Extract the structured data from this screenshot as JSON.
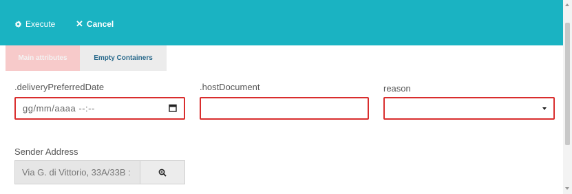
{
  "toolbar": {
    "execute_label": "Execute",
    "execute_icon": "gear-icon",
    "cancel_label": "Cancel",
    "cancel_icon": "close-icon",
    "background_color": "#1ab3c2"
  },
  "tabs": [
    {
      "label": "Main attributes",
      "active": true
    },
    {
      "label": "Empty Containers",
      "active": false
    }
  ],
  "form": {
    "delivery_date": {
      "label": ".deliveryPreferredDate",
      "placeholder": "gg/mm/aaaa --:--",
      "icon": "calendar-icon"
    },
    "host_document": {
      "label": ".hostDocument",
      "value": ""
    },
    "reason": {
      "label": "reason",
      "selected": "",
      "icon": "chevron-down-icon"
    },
    "sender_address": {
      "label": "Sender Address",
      "value": "Via G. di Vittorio, 33A/33B :",
      "icon": "search-icon"
    }
  },
  "colors": {
    "error_border": "#d92d2d",
    "active_tab": "#f7caca"
  }
}
